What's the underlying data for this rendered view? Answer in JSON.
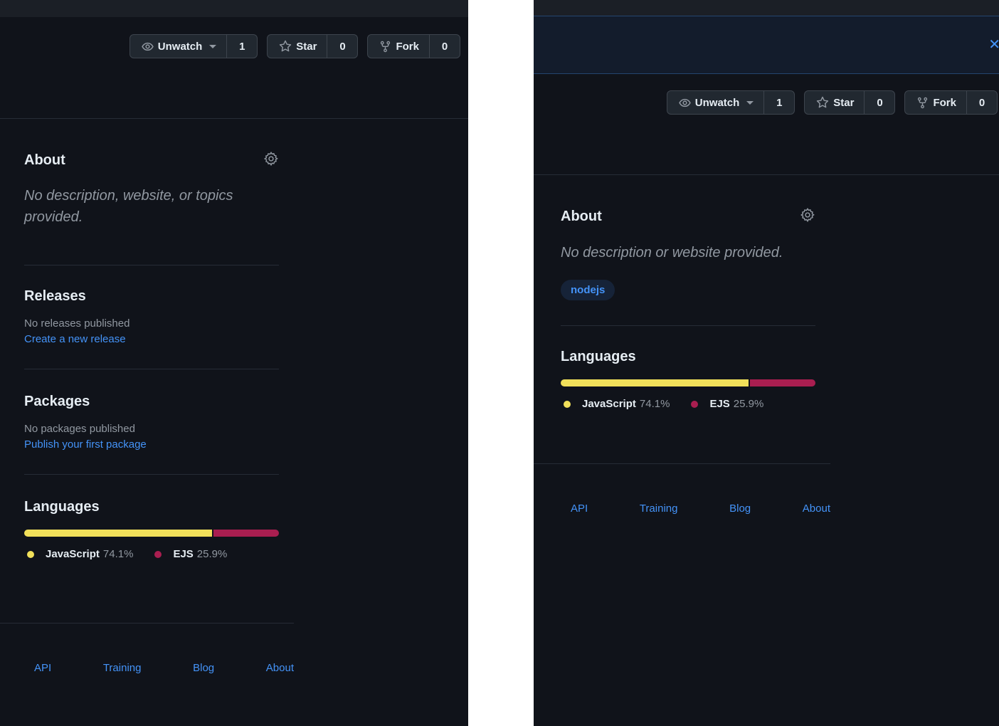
{
  "left": {
    "actions": {
      "unwatch_label": "Unwatch",
      "watch_count": "1",
      "star_label": "Star",
      "star_count": "0",
      "fork_label": "Fork",
      "fork_count": "0"
    },
    "about": {
      "title": "About",
      "description": "No description, website, or topics provided."
    },
    "releases": {
      "title": "Releases",
      "status": "No releases published",
      "link": "Create a new release"
    },
    "packages": {
      "title": "Packages",
      "status": "No packages published",
      "link": "Publish your first package"
    },
    "languages": {
      "title": "Languages",
      "items": [
        {
          "name": "JavaScript",
          "percent": "74.1%",
          "value": 74.1,
          "color": "#f1e05a"
        },
        {
          "name": "EJS",
          "percent": "25.9%",
          "value": 25.9,
          "color": "#a91e50"
        }
      ]
    },
    "footer": [
      "API",
      "Training",
      "Blog",
      "About"
    ]
  },
  "right": {
    "banner": {
      "close_icon": "close-icon"
    },
    "actions": {
      "unwatch_label": "Unwatch",
      "watch_count": "1",
      "star_label": "Star",
      "star_count": "0",
      "fork_label": "Fork",
      "fork_count": "0"
    },
    "about": {
      "title": "About",
      "description": "No description or website provided.",
      "topics": [
        "nodejs"
      ]
    },
    "languages": {
      "title": "Languages",
      "items": [
        {
          "name": "JavaScript",
          "percent": "74.1%",
          "value": 74.1,
          "color": "#f1e05a"
        },
        {
          "name": "EJS",
          "percent": "25.9%",
          "value": 25.9,
          "color": "#a91e50"
        }
      ]
    },
    "footer": [
      "API",
      "Training",
      "Blog",
      "About"
    ]
  },
  "icons": {
    "eye": "eye-icon",
    "star": "star-icon",
    "fork": "repo-forked-icon",
    "gear": "gear-icon",
    "close": "x-icon"
  },
  "colors": {
    "background": "#10131a",
    "link": "#4493f8",
    "javascript": "#f1e05a",
    "ejs": "#a91e50"
  }
}
